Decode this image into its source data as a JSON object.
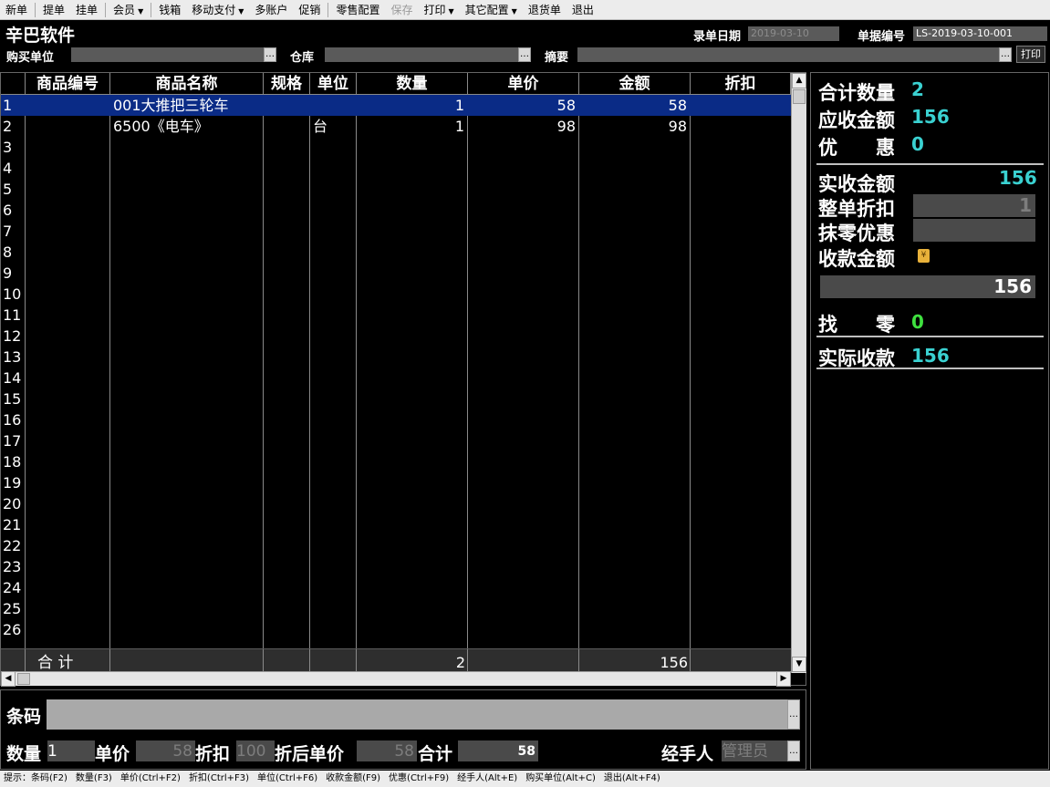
{
  "menu": [
    {
      "label": "新单",
      "name": "menu-new",
      "type": "item"
    },
    {
      "type": "sep"
    },
    {
      "label": "提单",
      "name": "menu-retrieve",
      "type": "item"
    },
    {
      "label": "挂单",
      "name": "menu-hold",
      "type": "item"
    },
    {
      "type": "sep"
    },
    {
      "label": "会员",
      "name": "menu-member",
      "type": "dropdown"
    },
    {
      "type": "sep"
    },
    {
      "label": "钱箱",
      "name": "menu-cashbox",
      "type": "item"
    },
    {
      "label": "移动支付",
      "name": "menu-mobile-pay",
      "type": "dropdown"
    },
    {
      "label": "多账户",
      "name": "menu-multi-account",
      "type": "item"
    },
    {
      "label": "促销",
      "name": "menu-promotion",
      "type": "item"
    },
    {
      "type": "sep"
    },
    {
      "label": "零售配置",
      "name": "menu-retail-config",
      "type": "item"
    },
    {
      "label": "保存",
      "name": "menu-save",
      "type": "item",
      "disabled": true
    },
    {
      "label": "打印",
      "name": "menu-print",
      "type": "dropdown"
    },
    {
      "label": "其它配置",
      "name": "menu-other-config",
      "type": "dropdown"
    },
    {
      "label": "退货单",
      "name": "menu-return",
      "type": "item"
    },
    {
      "label": "退出",
      "name": "menu-exit",
      "type": "item"
    }
  ],
  "header": {
    "app_title": "辛巴软件",
    "date_label": "录单日期",
    "date_value": "2019-03-10",
    "docno_label": "单据编号",
    "docno_value": "LS-2019-03-10-001",
    "buyer_label": "购买单位",
    "buyer_value": "",
    "warehouse_label": "仓库",
    "warehouse_value": "",
    "summary_label": "摘要",
    "summary_value": "",
    "ellipsis": "…",
    "print_label": "打印"
  },
  "grid": {
    "columns": [
      "",
      "商品编号",
      "商品名称",
      "规格",
      "单位",
      "数量",
      "单价",
      "金额",
      "折扣"
    ],
    "rows": [
      {
        "n": "1",
        "code": "",
        "name": "001大推把三轮车",
        "spec": "",
        "unit": "",
        "qty": "1",
        "price": "58",
        "amount": "58",
        "discount": ""
      },
      {
        "n": "2",
        "code": "",
        "name": "6500《电车》",
        "spec": "",
        "unit": "台",
        "qty": "1",
        "price": "98",
        "amount": "98",
        "discount": ""
      },
      {
        "n": "3"
      },
      {
        "n": "4"
      },
      {
        "n": "5"
      },
      {
        "n": "6"
      },
      {
        "n": "7"
      },
      {
        "n": "8"
      },
      {
        "n": "9"
      },
      {
        "n": "10"
      },
      {
        "n": "11"
      },
      {
        "n": "12"
      },
      {
        "n": "13"
      },
      {
        "n": "14"
      },
      {
        "n": "15"
      },
      {
        "n": "16"
      },
      {
        "n": "17"
      },
      {
        "n": "18"
      },
      {
        "n": "19"
      },
      {
        "n": "20"
      },
      {
        "n": "21"
      },
      {
        "n": "22"
      },
      {
        "n": "23"
      },
      {
        "n": "24"
      },
      {
        "n": "25"
      },
      {
        "n": "26"
      }
    ],
    "total_label": "合  计",
    "total_qty": "2",
    "total_amount": "156"
  },
  "entry": {
    "barcode_label": "条码",
    "barcode_value": "",
    "qty_label": "数量",
    "qty_value": "1",
    "price_label": "单价",
    "price_value": "58",
    "discount_label": "折扣",
    "discount_value": "100",
    "after_price_label": "折后单价",
    "after_price_value": "58",
    "total_label": "合计",
    "total_value": "58",
    "handler_label": "经手人",
    "handler_value": "管理员"
  },
  "summary": {
    "total_qty_label": "合计数量",
    "total_qty_value": "2",
    "receivable_label": "应收金额",
    "receivable_value": "156",
    "discount_label": "优　　惠",
    "discount_value": "0",
    "actual_label": "实收金额",
    "actual_value": "156",
    "order_discount_label": "整单折扣",
    "order_discount_value": "1",
    "rounding_label": "抹零优惠",
    "rounding_value": "",
    "payment_label": "收款金额",
    "payment_value": "156",
    "change_label": "找　　零",
    "change_value": "0",
    "real_label": "实际收款",
    "real_value": "156"
  },
  "status_hints": [
    "提示：条码(F2)",
    "数量(F3)",
    "单价(Ctrl+F2)",
    "折扣(Ctrl+F3)",
    "单位(Ctrl+F6)",
    "收款金额(F9)",
    "优惠(Ctrl+F9)",
    "经手人(Alt+E)",
    "购买单位(Alt+C)",
    "退出(Alt+F4)"
  ],
  "colors": {
    "selected_row": "#0a2b86",
    "summary_value": "#3ad1d1",
    "change_value": "#3fe03f"
  }
}
